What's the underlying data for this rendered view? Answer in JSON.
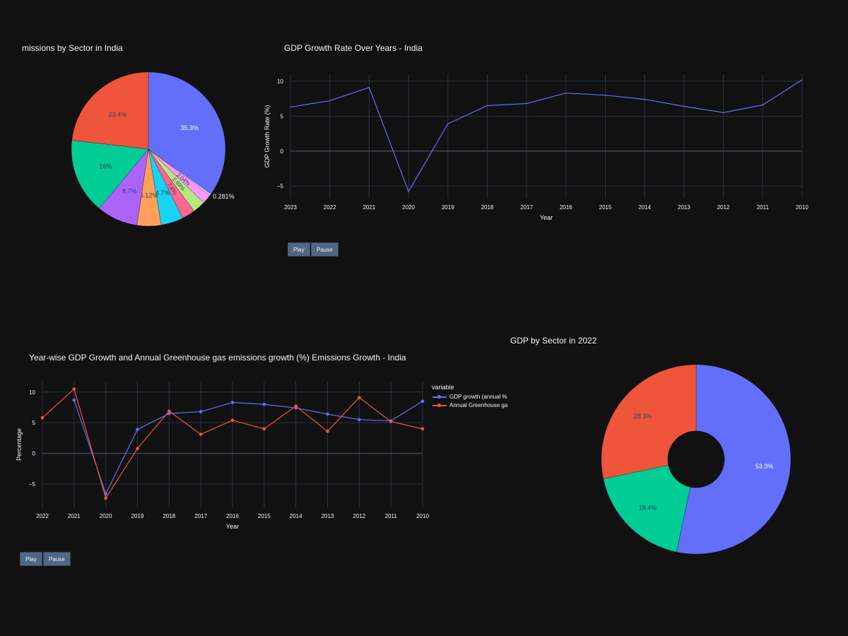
{
  "charts": {
    "pie_emissions": {
      "title": "missions by Sector in India"
    },
    "gdp_line": {
      "title": "GDP Growth Rate Over Years - India",
      "play_label": "Play",
      "pause_label": "Pause"
    },
    "combo_line": {
      "title": "Year-wise GDP Growth and Annual Greenhouse gas emissions growth (%) Emissions Growth - India",
      "legend_title": "variable",
      "play_label": "Play",
      "pause_label": "Pause"
    },
    "donut_gdp": {
      "title": "GDP by Sector in 2022"
    }
  },
  "chart_data": [
    {
      "type": "pie",
      "title": "missions by Sector in India",
      "labels": [
        "35.3%",
        "0.281%",
        "2.04%",
        "2.69%",
        "2.8%",
        "4.7%",
        "5.12%",
        "8.7%",
        "16%",
        "23.4%"
      ],
      "values": [
        35.3,
        0.281,
        2.04,
        2.69,
        2.8,
        4.7,
        5.12,
        8.7,
        16,
        23.4
      ],
      "colors": [
        "#636efa",
        "#ffffff",
        "#ff97ff",
        "#b6e880",
        "#ff6692",
        "#19d3f3",
        "#ffa15a",
        "#ab63fa",
        "#00cc96",
        "#ef553b"
      ]
    },
    {
      "type": "line",
      "title": "GDP Growth Rate Over Years - India",
      "xlabel": "Year",
      "ylabel": "GDP Growth Rate (%)",
      "x": [
        "2023",
        "2022",
        "2021",
        "2020",
        "2019",
        "2018",
        "2017",
        "2016",
        "2015",
        "2014",
        "2013",
        "2012",
        "2011",
        "2010"
      ],
      "y": [
        6.3,
        7.2,
        9.1,
        -5.8,
        3.9,
        6.5,
        6.8,
        8.3,
        8.0,
        7.4,
        6.4,
        5.5,
        6.6,
        10.2
      ],
      "yticks": [
        -5,
        0,
        5,
        10
      ],
      "ylim": [
        -6.8,
        11
      ],
      "color": "#636efa"
    },
    {
      "type": "line",
      "title": "Year-wise GDP Growth and Annual Greenhouse gas emissions growth (%) Emissions Growth - India",
      "xlabel": "Year",
      "ylabel": "Percentage",
      "x": [
        "2022",
        "2021",
        "2020",
        "2019",
        "2018",
        "2017",
        "2016",
        "2015",
        "2014",
        "2013",
        "2012",
        "2011",
        "2010"
      ],
      "yticks": [
        -5,
        0,
        5,
        10
      ],
      "ylim": [
        -8.8,
        11.7
      ],
      "legend_title": "variable",
      "series": [
        {
          "name": "GDP growth (annual %",
          "color": "#636efa",
          "values": [
            null,
            8.7,
            -6.6,
            3.9,
            6.5,
            6.8,
            8.3,
            8.0,
            7.4,
            6.4,
            5.5,
            5.3,
            8.5
          ]
        },
        {
          "name": "Annual Greenhouse ga",
          "color": "#ef553b",
          "values": [
            5.8,
            10.5,
            -7.3,
            0.8,
            6.9,
            3.1,
            5.4,
            4.0,
            7.7,
            3.6,
            9.1,
            5.2,
            4.0
          ]
        }
      ]
    },
    {
      "type": "pie",
      "title": "GDP by Sector in 2022",
      "hole": 0.3,
      "labels": [
        "53.3%",
        "18.4%",
        "28.3%"
      ],
      "values": [
        53.3,
        18.4,
        28.3
      ],
      "colors": [
        "#636efa",
        "#00cc96",
        "#ef553b"
      ]
    }
  ]
}
